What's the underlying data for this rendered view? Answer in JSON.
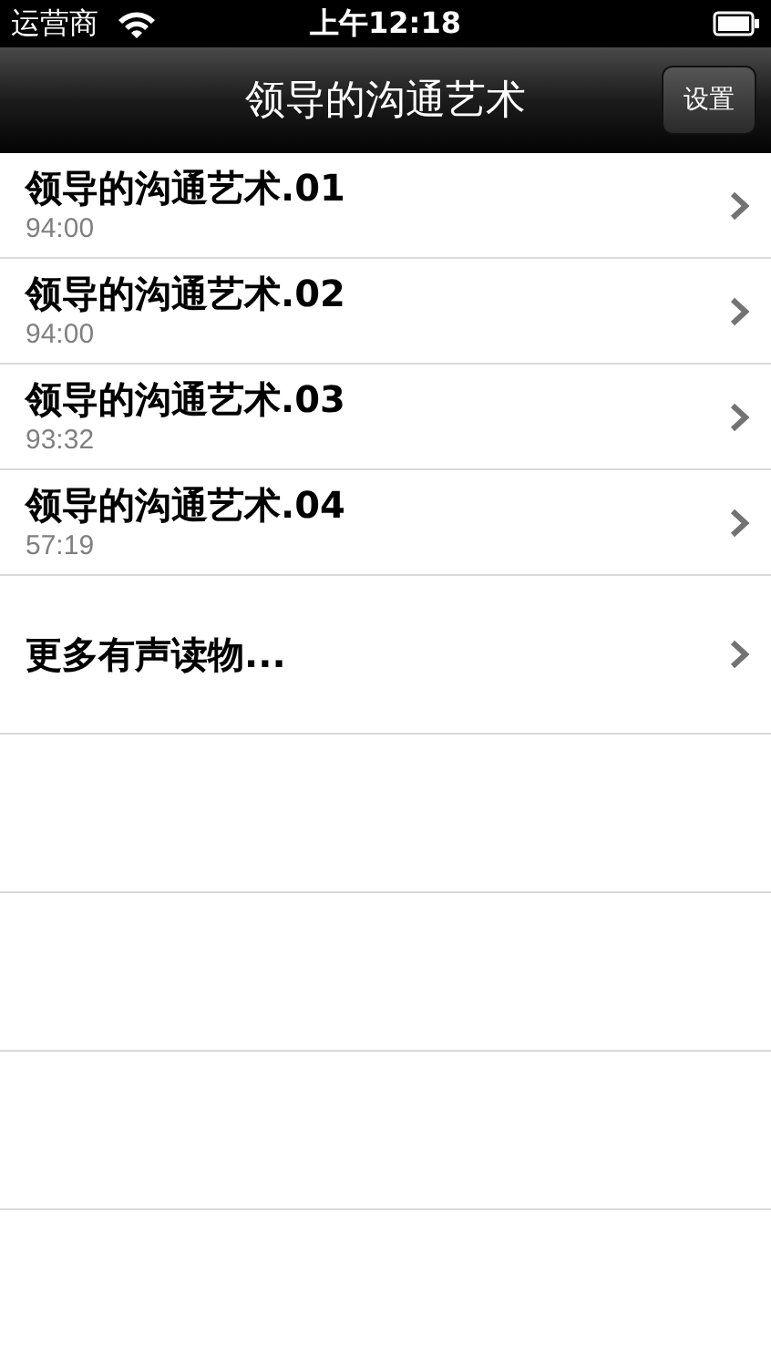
{
  "status_bar": {
    "carrier": "运营商",
    "time": "上午12:18"
  },
  "nav_bar": {
    "title": "领导的沟通艺术",
    "button": "设置"
  },
  "episodes": [
    {
      "title": "领导的沟通艺术.01",
      "duration": "94:00"
    },
    {
      "title": "领导的沟通艺术.02",
      "duration": "94:00"
    },
    {
      "title": "领导的沟通艺术.03",
      "duration": "93:32"
    },
    {
      "title": "领导的沟通艺术.04",
      "duration": "57:19"
    }
  ],
  "more": {
    "label": "更多有声读物..."
  }
}
